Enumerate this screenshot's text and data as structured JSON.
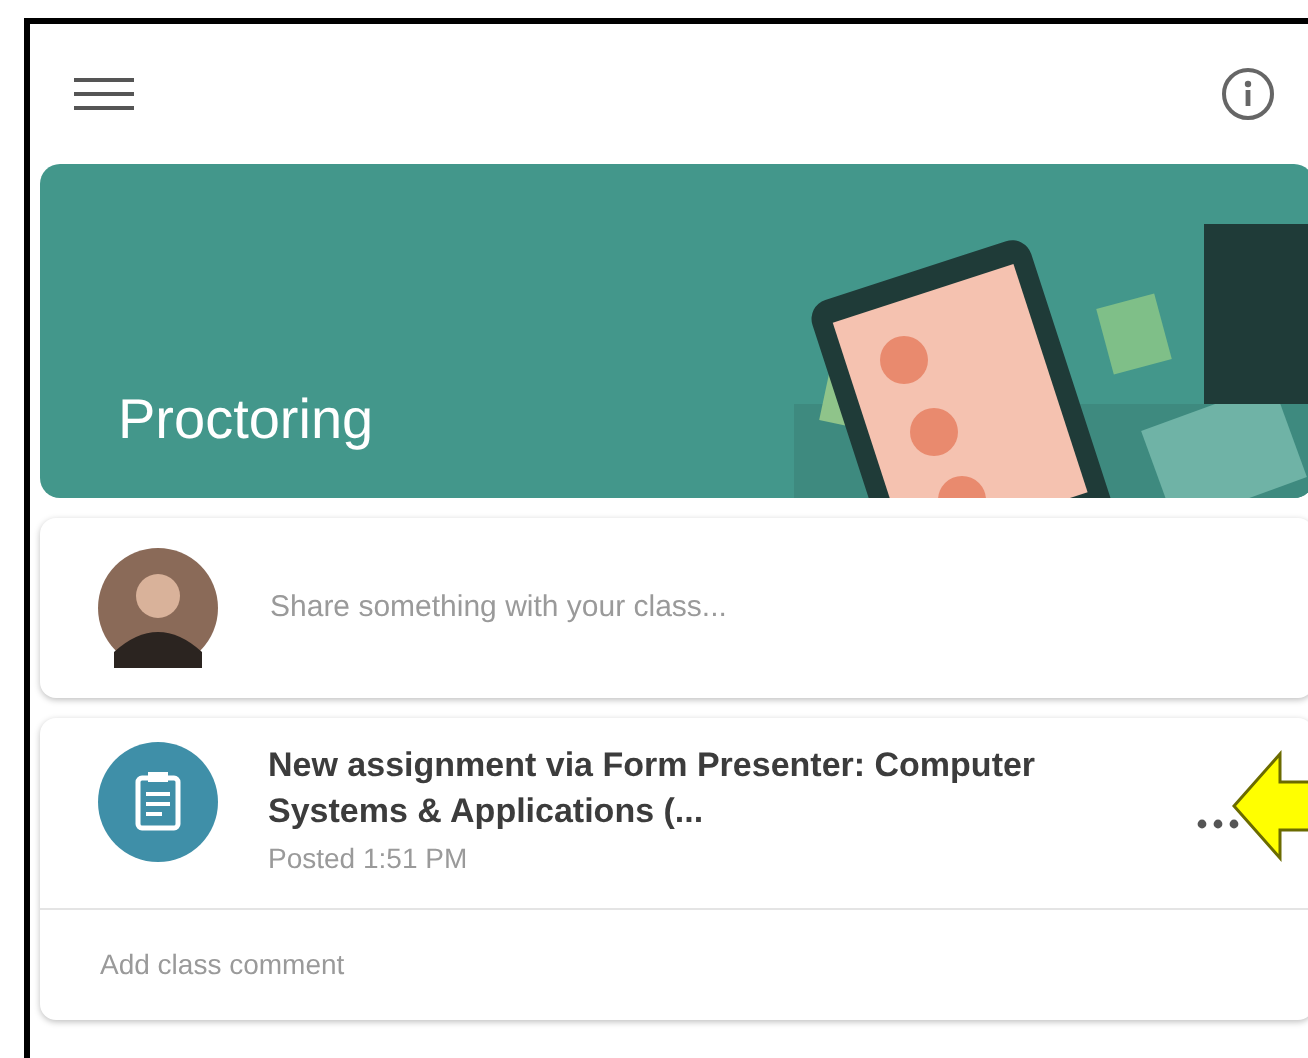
{
  "class_banner": {
    "title": "Proctoring"
  },
  "share_box": {
    "placeholder": "Share something with your class..."
  },
  "posts": [
    {
      "kind": "assignment",
      "title": "New assignment via Form Presenter: Computer Systems & Applications (...",
      "posted": "Posted 1:51 PM",
      "comment_placeholder": "Add class comment",
      "highlighted": true
    }
  ]
}
